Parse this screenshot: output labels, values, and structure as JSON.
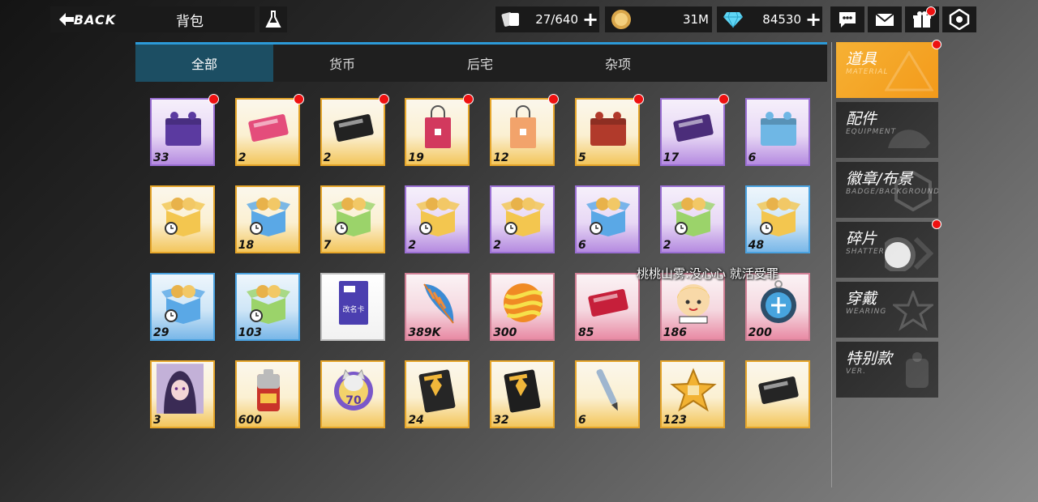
{
  "header": {
    "back_label": "BACK",
    "title": "背包"
  },
  "resources": [
    {
      "name": "card-icon",
      "value": "27/640",
      "has_plus": true
    },
    {
      "name": "coin-icon",
      "value": "31M",
      "has_plus": false
    },
    {
      "name": "diamond-icon",
      "value": "84530",
      "has_plus": true
    }
  ],
  "top_icons": [
    "chat-icon",
    "mail-icon",
    "gift-icon",
    "settings-icon"
  ],
  "tabs": [
    {
      "label": "全部",
      "active": true
    },
    {
      "label": "货币",
      "active": false
    },
    {
      "label": "后宅",
      "active": false
    },
    {
      "label": "杂项",
      "active": false
    }
  ],
  "items": [
    {
      "name": "purple-ticket-box",
      "count": "33",
      "rarity": "purple",
      "new": true,
      "icon": "box"
    },
    {
      "name": "pink-ticket",
      "count": "2",
      "rarity": "gold",
      "new": true,
      "icon": "ticket"
    },
    {
      "name": "black-ticket",
      "count": "2",
      "rarity": "gold",
      "new": true,
      "icon": "ticket"
    },
    {
      "name": "pink-bag",
      "count": "19",
      "rarity": "gold",
      "new": true,
      "icon": "bag"
    },
    {
      "name": "shopping-bag",
      "count": "12",
      "rarity": "gold",
      "new": true,
      "icon": "bag"
    },
    {
      "name": "red-box",
      "count": "5",
      "rarity": "gold",
      "new": true,
      "icon": "box"
    },
    {
      "name": "purple-ticket",
      "count": "17",
      "rarity": "purple",
      "new": true,
      "icon": "ticket"
    },
    {
      "name": "blue-box",
      "count": "6",
      "rarity": "purple",
      "new": false,
      "icon": "box"
    },
    {
      "name": "gold-timed-box-1",
      "count": "",
      "rarity": "gold",
      "new": false,
      "icon": "openbox"
    },
    {
      "name": "blue-timed-box",
      "count": "18",
      "rarity": "gold",
      "new": false,
      "icon": "openbox"
    },
    {
      "name": "green-timed-box",
      "count": "7",
      "rarity": "gold",
      "new": false,
      "icon": "openbox"
    },
    {
      "name": "gold-timed-box-2",
      "count": "2",
      "rarity": "purple",
      "new": false,
      "icon": "openbox"
    },
    {
      "name": "gold-timed-box-3",
      "count": "2",
      "rarity": "purple",
      "new": false,
      "icon": "openbox"
    },
    {
      "name": "blue-timed-box-2",
      "count": "6",
      "rarity": "purple",
      "new": false,
      "icon": "openbox"
    },
    {
      "name": "green-timed-box-2",
      "count": "2",
      "rarity": "purple",
      "new": false,
      "icon": "openbox"
    },
    {
      "name": "gold-timed-box-4",
      "count": "48",
      "rarity": "blue",
      "new": false,
      "icon": "openbox"
    },
    {
      "name": "blue-timed-box-3",
      "count": "29",
      "rarity": "blue",
      "new": false,
      "icon": "openbox"
    },
    {
      "name": "green-timed-box-3",
      "count": "103",
      "rarity": "blue",
      "new": false,
      "icon": "openbox"
    },
    {
      "name": "rename-card",
      "count": "",
      "rarity": "white",
      "new": false,
      "icon": "card"
    },
    {
      "name": "feather",
      "count": "389K",
      "rarity": "pink",
      "new": false,
      "icon": "feather"
    },
    {
      "name": "striped-ball",
      "count": "300",
      "rarity": "pink",
      "new": false,
      "icon": "ball"
    },
    {
      "name": "lucky-ticket",
      "count": "85",
      "rarity": "pink",
      "new": false,
      "icon": "ticket"
    },
    {
      "name": "figure-coin",
      "count": "186",
      "rarity": "pink",
      "new": false,
      "icon": "face"
    },
    {
      "name": "blue-medal",
      "count": "200",
      "rarity": "pink",
      "new": false,
      "icon": "medal"
    },
    {
      "name": "character-portrait",
      "count": "3",
      "rarity": "gold",
      "new": false,
      "icon": "portrait"
    },
    {
      "name": "battery",
      "count": "600",
      "rarity": "gold",
      "new": false,
      "icon": "battery"
    },
    {
      "name": "cat-badge-70",
      "count": "",
      "rarity": "gold",
      "new": false,
      "icon": "catbadge"
    },
    {
      "name": "badge-book",
      "count": "24",
      "rarity": "gold",
      "new": false,
      "icon": "book"
    },
    {
      "name": "black-book",
      "count": "32",
      "rarity": "gold",
      "new": false,
      "icon": "book"
    },
    {
      "name": "pen",
      "count": "6",
      "rarity": "gold",
      "new": false,
      "icon": "pen"
    },
    {
      "name": "gold-star",
      "count": "123",
      "rarity": "gold",
      "new": false,
      "icon": "star"
    },
    {
      "name": "black-card",
      "count": "",
      "rarity": "gold",
      "new": false,
      "icon": "ticket"
    }
  ],
  "overlay_text": "桃桃山雾:没心心 就活受罪",
  "categories": [
    {
      "label": "道具",
      "sub": "MATERIAL",
      "active": true,
      "new": true
    },
    {
      "label": "配件",
      "sub": "EQUIPMENT",
      "active": false,
      "new": false
    },
    {
      "label": "徽章/布景",
      "sub": "BADGE/BACKGROUND",
      "active": false,
      "new": false
    },
    {
      "label": "碎片",
      "sub": "SHATTER",
      "active": false,
      "new": true
    },
    {
      "label": "穿戴",
      "sub": "WEARING",
      "active": false,
      "new": false
    },
    {
      "label": "特别款",
      "sub": "VER.",
      "active": false,
      "new": false
    }
  ]
}
